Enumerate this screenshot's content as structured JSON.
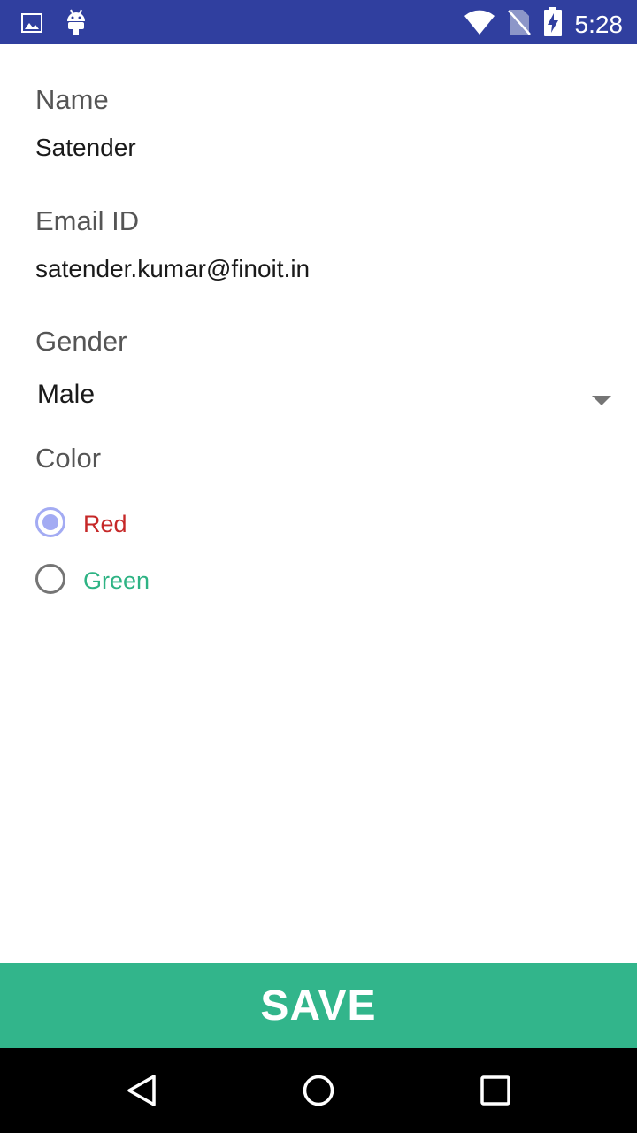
{
  "status_bar": {
    "time": "5:28",
    "icons": [
      "image-icon",
      "android-icon",
      "wifi-icon",
      "no-sim-icon",
      "battery-charging-icon"
    ],
    "background": "#303f9f"
  },
  "form": {
    "name": {
      "label": "Name",
      "value": "Satender"
    },
    "email": {
      "label": "Email ID",
      "value": "satender.kumar@finoit.in"
    },
    "gender": {
      "label": "Gender",
      "selected": "Male"
    },
    "color": {
      "label": "Color",
      "options": [
        {
          "label": "Red",
          "checked": true,
          "text_color": "#c62828"
        },
        {
          "label": "Green",
          "checked": false,
          "text_color": "#2eb384"
        }
      ]
    }
  },
  "save_button": {
    "label": "SAVE",
    "background": "#32b58b"
  },
  "nav_bar": {
    "buttons": [
      "back-icon",
      "home-icon",
      "recents-icon"
    ]
  }
}
